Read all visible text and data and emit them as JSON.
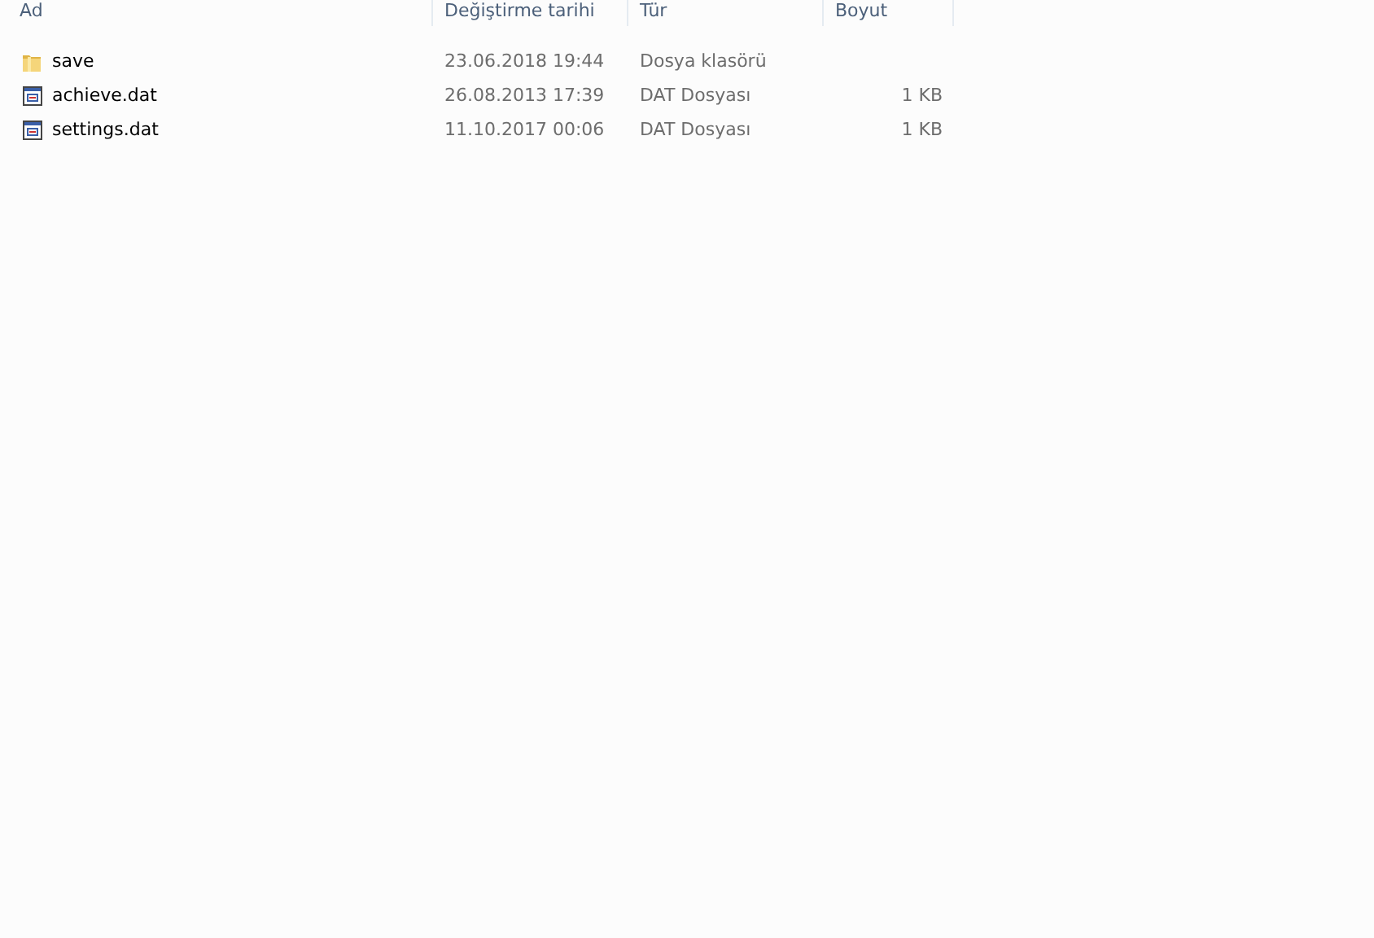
{
  "columns": [
    "Ad",
    "Değiştirme tarihi",
    "Tür",
    "Boyut"
  ],
  "rows": [
    {
      "kind": "folder",
      "name": "save",
      "modified": "23.06.2018 19:44",
      "type": "Dosya klasörü"
    },
    {
      "kind": "file",
      "name": "achieve.dat",
      "modified": "26.08.2013 17:39",
      "type": "DAT Dosyası",
      "size": "1 KB"
    },
    {
      "kind": "file",
      "name": "settings.dat",
      "modified": "11.10.2017 00:06",
      "type": "DAT Dosyası",
      "size": "1 KB"
    }
  ]
}
